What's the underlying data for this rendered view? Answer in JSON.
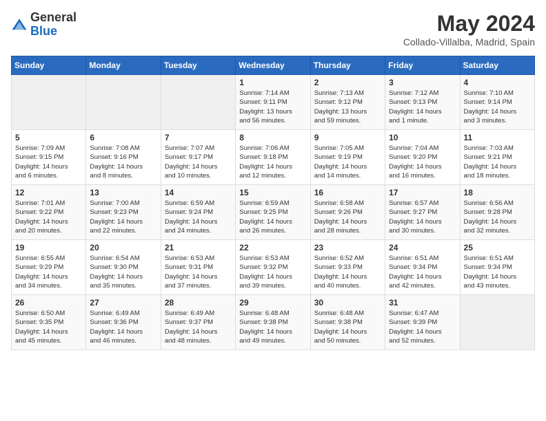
{
  "header": {
    "logo_general": "General",
    "logo_blue": "Blue",
    "title": "May 2024",
    "subtitle": "Collado-Villalba, Madrid, Spain"
  },
  "days_of_week": [
    "Sunday",
    "Monday",
    "Tuesday",
    "Wednesday",
    "Thursday",
    "Friday",
    "Saturday"
  ],
  "weeks": [
    [
      {
        "day": "",
        "info": ""
      },
      {
        "day": "",
        "info": ""
      },
      {
        "day": "",
        "info": ""
      },
      {
        "day": "1",
        "info": "Sunrise: 7:14 AM\nSunset: 9:11 PM\nDaylight: 13 hours\nand 56 minutes."
      },
      {
        "day": "2",
        "info": "Sunrise: 7:13 AM\nSunset: 9:12 PM\nDaylight: 13 hours\nand 59 minutes."
      },
      {
        "day": "3",
        "info": "Sunrise: 7:12 AM\nSunset: 9:13 PM\nDaylight: 14 hours\nand 1 minute."
      },
      {
        "day": "4",
        "info": "Sunrise: 7:10 AM\nSunset: 9:14 PM\nDaylight: 14 hours\nand 3 minutes."
      }
    ],
    [
      {
        "day": "5",
        "info": "Sunrise: 7:09 AM\nSunset: 9:15 PM\nDaylight: 14 hours\nand 6 minutes."
      },
      {
        "day": "6",
        "info": "Sunrise: 7:08 AM\nSunset: 9:16 PM\nDaylight: 14 hours\nand 8 minutes."
      },
      {
        "day": "7",
        "info": "Sunrise: 7:07 AM\nSunset: 9:17 PM\nDaylight: 14 hours\nand 10 minutes."
      },
      {
        "day": "8",
        "info": "Sunrise: 7:06 AM\nSunset: 9:18 PM\nDaylight: 14 hours\nand 12 minutes."
      },
      {
        "day": "9",
        "info": "Sunrise: 7:05 AM\nSunset: 9:19 PM\nDaylight: 14 hours\nand 14 minutes."
      },
      {
        "day": "10",
        "info": "Sunrise: 7:04 AM\nSunset: 9:20 PM\nDaylight: 14 hours\nand 16 minutes."
      },
      {
        "day": "11",
        "info": "Sunrise: 7:03 AM\nSunset: 9:21 PM\nDaylight: 14 hours\nand 18 minutes."
      }
    ],
    [
      {
        "day": "12",
        "info": "Sunrise: 7:01 AM\nSunset: 9:22 PM\nDaylight: 14 hours\nand 20 minutes."
      },
      {
        "day": "13",
        "info": "Sunrise: 7:00 AM\nSunset: 9:23 PM\nDaylight: 14 hours\nand 22 minutes."
      },
      {
        "day": "14",
        "info": "Sunrise: 6:59 AM\nSunset: 9:24 PM\nDaylight: 14 hours\nand 24 minutes."
      },
      {
        "day": "15",
        "info": "Sunrise: 6:59 AM\nSunset: 9:25 PM\nDaylight: 14 hours\nand 26 minutes."
      },
      {
        "day": "16",
        "info": "Sunrise: 6:58 AM\nSunset: 9:26 PM\nDaylight: 14 hours\nand 28 minutes."
      },
      {
        "day": "17",
        "info": "Sunrise: 6:57 AM\nSunset: 9:27 PM\nDaylight: 14 hours\nand 30 minutes."
      },
      {
        "day": "18",
        "info": "Sunrise: 6:56 AM\nSunset: 9:28 PM\nDaylight: 14 hours\nand 32 minutes."
      }
    ],
    [
      {
        "day": "19",
        "info": "Sunrise: 6:55 AM\nSunset: 9:29 PM\nDaylight: 14 hours\nand 34 minutes."
      },
      {
        "day": "20",
        "info": "Sunrise: 6:54 AM\nSunset: 9:30 PM\nDaylight: 14 hours\nand 35 minutes."
      },
      {
        "day": "21",
        "info": "Sunrise: 6:53 AM\nSunset: 9:31 PM\nDaylight: 14 hours\nand 37 minutes."
      },
      {
        "day": "22",
        "info": "Sunrise: 6:53 AM\nSunset: 9:32 PM\nDaylight: 14 hours\nand 39 minutes."
      },
      {
        "day": "23",
        "info": "Sunrise: 6:52 AM\nSunset: 9:33 PM\nDaylight: 14 hours\nand 40 minutes."
      },
      {
        "day": "24",
        "info": "Sunrise: 6:51 AM\nSunset: 9:34 PM\nDaylight: 14 hours\nand 42 minutes."
      },
      {
        "day": "25",
        "info": "Sunrise: 6:51 AM\nSunset: 9:34 PM\nDaylight: 14 hours\nand 43 minutes."
      }
    ],
    [
      {
        "day": "26",
        "info": "Sunrise: 6:50 AM\nSunset: 9:35 PM\nDaylight: 14 hours\nand 45 minutes."
      },
      {
        "day": "27",
        "info": "Sunrise: 6:49 AM\nSunset: 9:36 PM\nDaylight: 14 hours\nand 46 minutes."
      },
      {
        "day": "28",
        "info": "Sunrise: 6:49 AM\nSunset: 9:37 PM\nDaylight: 14 hours\nand 48 minutes."
      },
      {
        "day": "29",
        "info": "Sunrise: 6:48 AM\nSunset: 9:38 PM\nDaylight: 14 hours\nand 49 minutes."
      },
      {
        "day": "30",
        "info": "Sunrise: 6:48 AM\nSunset: 9:38 PM\nDaylight: 14 hours\nand 50 minutes."
      },
      {
        "day": "31",
        "info": "Sunrise: 6:47 AM\nSunset: 9:39 PM\nDaylight: 14 hours\nand 52 minutes."
      },
      {
        "day": "",
        "info": ""
      }
    ]
  ]
}
